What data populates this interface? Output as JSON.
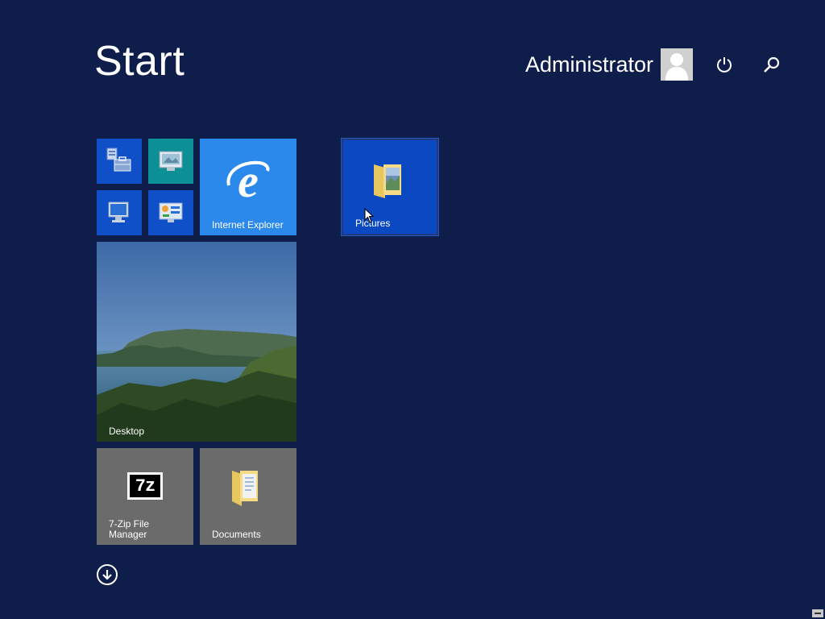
{
  "screen": {
    "title": "Start",
    "user": {
      "name": "Administrator",
      "avatar_icon": "user-avatar-icon"
    },
    "power_icon": "power-icon",
    "search_icon": "search-icon"
  },
  "tiles": {
    "server_manager": {
      "icon": "server-manager-icon"
    },
    "control_panel": {
      "icon": "control-panel-icon"
    },
    "this_pc": {
      "icon": "this-pc-icon"
    },
    "task_manager": {
      "icon": "task-manager-icon"
    },
    "internet_explorer": {
      "label": "Internet Explorer",
      "icon": "internet-explorer-icon"
    },
    "pictures": {
      "label": "Pictures",
      "icon": "pictures-folder-icon"
    },
    "desktop": {
      "label": "Desktop"
    },
    "seven_zip": {
      "label_line1": "7-Zip File",
      "label_line2": "Manager",
      "logo_text": "7z"
    },
    "documents": {
      "label": "Documents",
      "icon": "documents-folder-icon"
    }
  },
  "all_apps_icon": "down-arrow-icon",
  "colors": {
    "background": "#0e1d4a",
    "tile_blue": "#0f50c8",
    "tile_teal": "#0d8f96",
    "tile_ie": "#2c89ec",
    "tile_gray": "#6b6b6b"
  }
}
